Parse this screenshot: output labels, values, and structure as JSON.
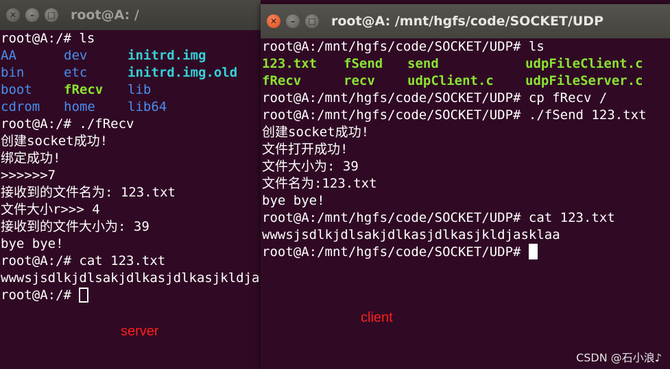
{
  "server": {
    "title": "root@A: /",
    "ls_command": "root@A:/# ls",
    "ls_rows": [
      [
        {
          "text": "AA",
          "style": "blue"
        },
        {
          "text": "dev",
          "style": "blue"
        },
        {
          "text": "initrd.img",
          "style": "cyan"
        }
      ],
      [
        {
          "text": "bin",
          "style": "blue"
        },
        {
          "text": "etc",
          "style": "blue"
        },
        {
          "text": "initrd.img.old",
          "style": "cyan"
        }
      ],
      [
        {
          "text": "boot",
          "style": "blue"
        },
        {
          "text": "fRecv",
          "style": "green"
        },
        {
          "text": "lib",
          "style": "blue"
        }
      ],
      [
        {
          "text": "cdrom",
          "style": "blue"
        },
        {
          "text": "home",
          "style": "blue"
        },
        {
          "text": "lib64",
          "style": "blue"
        }
      ]
    ],
    "output_lines": [
      "root@A:/# ./fRecv",
      "创建socket成功!",
      "绑定成功!",
      ">>>>>>7",
      "接收到的文件名为: 123.txt",
      "文件大小r>>> 4",
      "接收到的文件大小为: 39",
      "bye bye!",
      "root@A:/# cat 123.txt",
      "wwwsjsdlkjdlsakjdlkasjdlkasjkldjasklaa"
    ],
    "prompt": "root@A:/# "
  },
  "client": {
    "title": "root@A: /mnt/hgfs/code/SOCKET/UDP",
    "ls_command": "root@A:/mnt/hgfs/code/SOCKET/UDP# ls",
    "ls_rows": [
      [
        {
          "text": "123.txt",
          "style": "green"
        },
        {
          "text": "fSend",
          "style": "green"
        },
        {
          "text": "send",
          "style": "green"
        },
        {
          "text": "udpFileClient.c",
          "style": "green"
        }
      ],
      [
        {
          "text": "fRecv",
          "style": "green"
        },
        {
          "text": "recv",
          "style": "green"
        },
        {
          "text": "udpClient.c",
          "style": "green"
        },
        {
          "text": "udpFileServer.c",
          "style": "green"
        }
      ]
    ],
    "output_lines": [
      "root@A:/mnt/hgfs/code/SOCKET/UDP# cp fRecv /",
      "root@A:/mnt/hgfs/code/SOCKET/UDP# ./fSend 123.txt",
      "创建socket成功!",
      "文件打开成功!",
      "文件大小为: 39",
      "文件名为:123.txt",
      "bye bye!",
      "root@A:/mnt/hgfs/code/SOCKET/UDP# cat 123.txt",
      "wwwsjsdlkjdlsakjdlkasjdlkasjkldjasklaa"
    ],
    "prompt": "root@A:/mnt/hgfs/code/SOCKET/UDP# "
  },
  "labels": {
    "server": "server",
    "client": "client",
    "watermark": "CSDN @石小浪♪"
  },
  "colors": {
    "terminal_bg": "#300a24",
    "dir_blue": "#4a8ef0",
    "exec_green": "#8ae234",
    "link_cyan": "#36d0d8",
    "annotation_red": "#ff1e1e",
    "close_orange": "#df4b16"
  }
}
